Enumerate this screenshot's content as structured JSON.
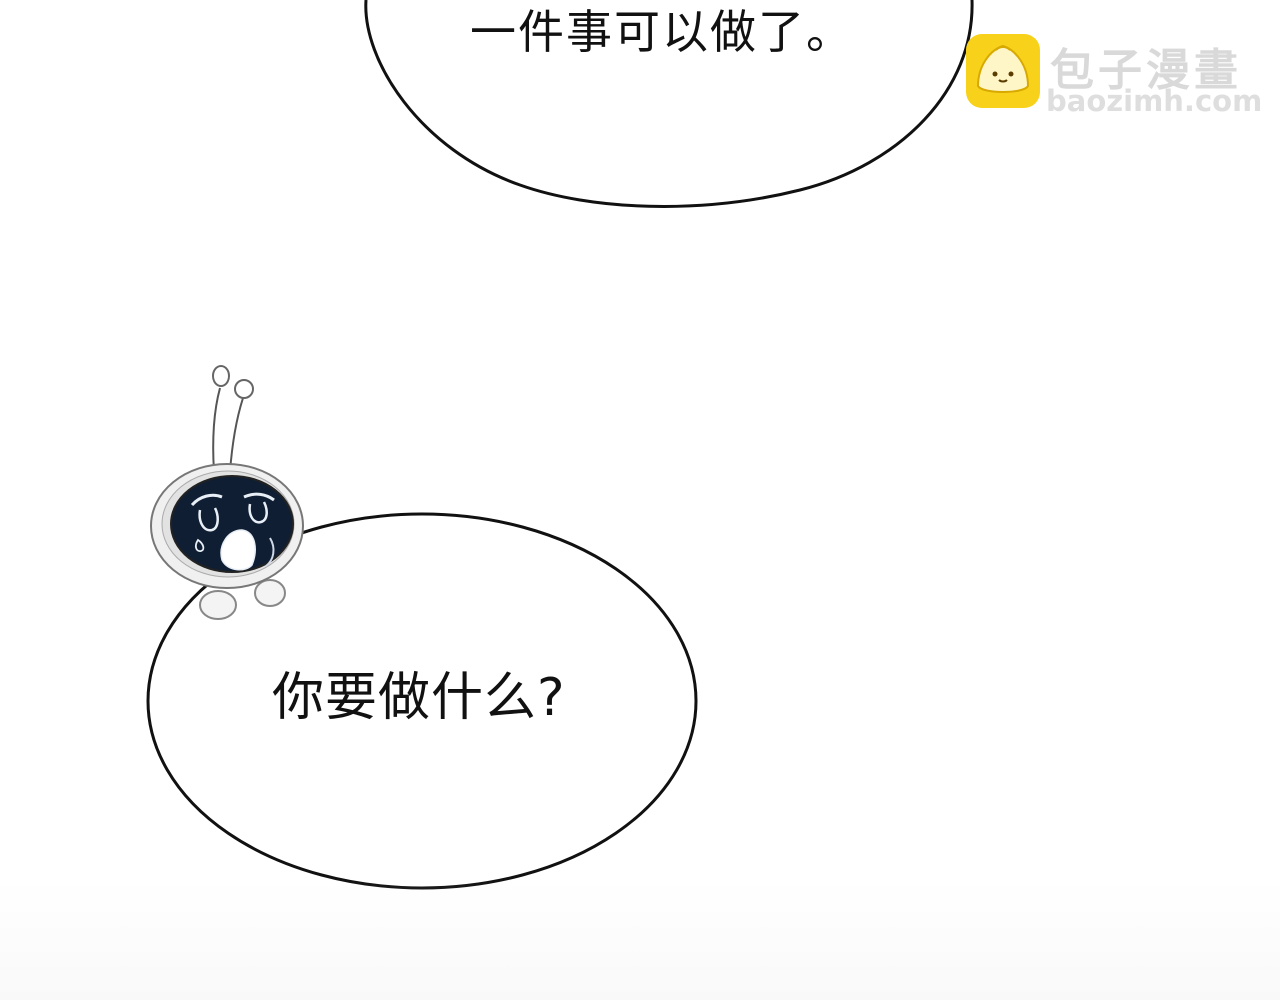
{
  "panel": {
    "top_bubble_text": "一件事可以做了。",
    "bottom_bubble_text": "你要做什么?"
  },
  "watermark": {
    "title": "包子漫畫",
    "url": "baozimh.com",
    "logo_color": "#f8d21a"
  },
  "colors": {
    "background": "#ffffff",
    "bubble_outline": "#111111",
    "robot_screen": "#0f1e33"
  }
}
